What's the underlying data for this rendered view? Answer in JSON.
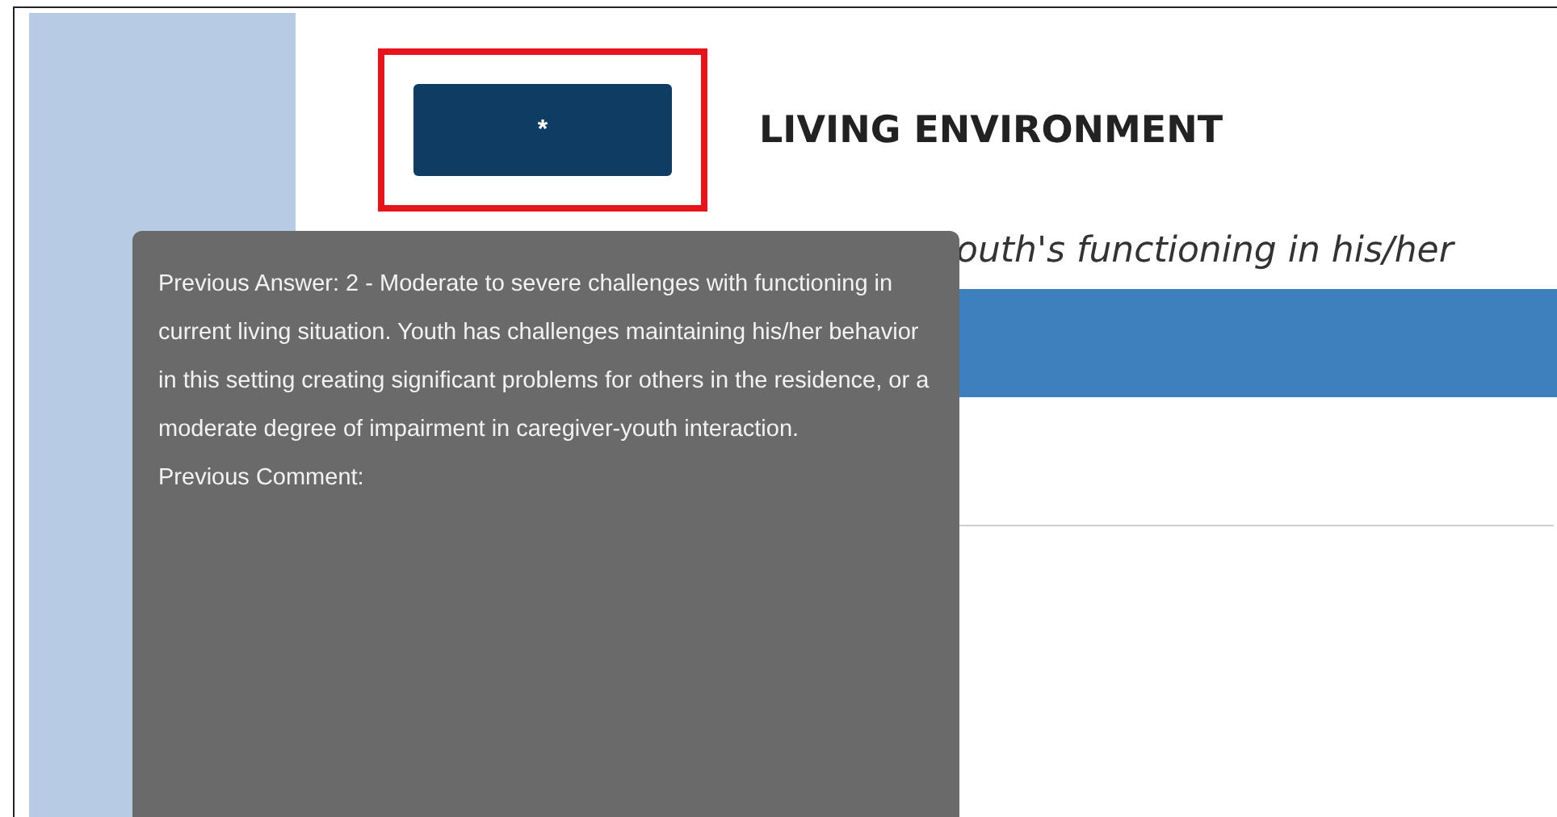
{
  "section": {
    "title": "LIVING ENVIRONMENT",
    "rating_button": {
      "label": "*",
      "highlighted": true
    }
  },
  "question": {
    "text": "outh's functioning in his/her"
  },
  "tooltip": {
    "lines": [
      "Previous Answer: 2 - Moderate to severe challenges with functioning in current living situation. Youth has challenges maintaining his/her behavior in this setting creating significant problems for others in the residence, or a moderate degree of impairment in caregiver-youth interaction.",
      "Previous Comment:"
    ]
  }
}
